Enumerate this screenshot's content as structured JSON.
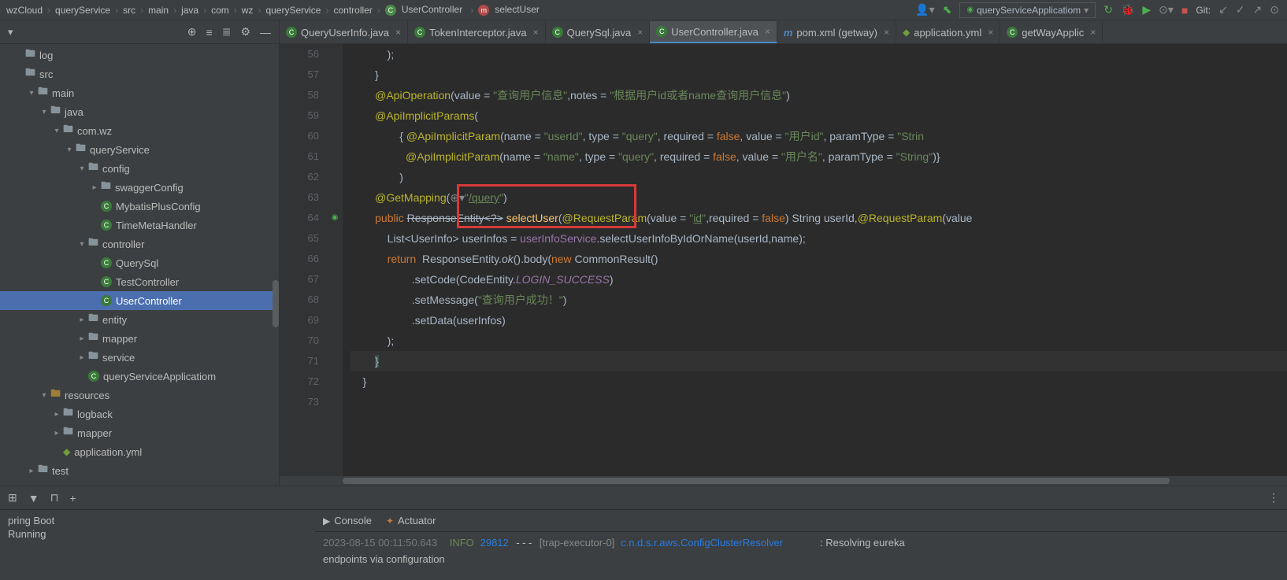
{
  "breadcrumb": [
    "wzCloud",
    "queryService",
    "src",
    "main",
    "java",
    "com",
    "wz",
    "queryService",
    "controller",
    "UserController",
    "selectUser"
  ],
  "runConfig": "queryServiceApplicatiom",
  "gitLabel": "Git:",
  "tree": {
    "items": [
      {
        "label": "log",
        "indent": 1,
        "kind": "folder",
        "arrow": ""
      },
      {
        "label": "src",
        "indent": 1,
        "kind": "folder",
        "arrow": ""
      },
      {
        "label": "main",
        "indent": 2,
        "kind": "folder",
        "arrow": "▾"
      },
      {
        "label": "java",
        "indent": 3,
        "kind": "folder",
        "arrow": "▾"
      },
      {
        "label": "com.wz",
        "indent": 4,
        "kind": "folder",
        "arrow": "▾"
      },
      {
        "label": "queryService",
        "indent": 5,
        "kind": "folder",
        "arrow": "▾"
      },
      {
        "label": "config",
        "indent": 6,
        "kind": "folder",
        "arrow": "▾"
      },
      {
        "label": "swaggerConfig",
        "indent": 7,
        "kind": "folder",
        "arrow": "▸"
      },
      {
        "label": "MybatisPlusConfig",
        "indent": 7,
        "kind": "class",
        "arrow": ""
      },
      {
        "label": "TimeMetaHandler",
        "indent": 7,
        "kind": "class",
        "arrow": ""
      },
      {
        "label": "controller",
        "indent": 6,
        "kind": "folder",
        "arrow": "▾"
      },
      {
        "label": "QuerySql",
        "indent": 7,
        "kind": "class",
        "arrow": ""
      },
      {
        "label": "TestController",
        "indent": 7,
        "kind": "class",
        "arrow": ""
      },
      {
        "label": "UserController",
        "indent": 7,
        "kind": "class",
        "arrow": "",
        "selected": true
      },
      {
        "label": "entity",
        "indent": 6,
        "kind": "folder",
        "arrow": "▸"
      },
      {
        "label": "mapper",
        "indent": 6,
        "kind": "folder",
        "arrow": "▸"
      },
      {
        "label": "service",
        "indent": 6,
        "kind": "folder",
        "arrow": "▸"
      },
      {
        "label": "queryServiceApplicatiom",
        "indent": 6,
        "kind": "class-run",
        "arrow": ""
      },
      {
        "label": "resources",
        "indent": 3,
        "kind": "folder-res",
        "arrow": "▾"
      },
      {
        "label": "logback",
        "indent": 4,
        "kind": "folder",
        "arrow": "▸"
      },
      {
        "label": "mapper",
        "indent": 4,
        "kind": "folder",
        "arrow": "▸"
      },
      {
        "label": "application.yml",
        "indent": 4,
        "kind": "yml",
        "arrow": ""
      },
      {
        "label": "test",
        "indent": 2,
        "kind": "folder",
        "arrow": "▸"
      }
    ]
  },
  "tabs": [
    {
      "label": "QueryUserInfo.java",
      "icon": "c"
    },
    {
      "label": "TokenInterceptor.java",
      "icon": "c"
    },
    {
      "label": "QuerySql.java",
      "icon": "c"
    },
    {
      "label": "UserController.java",
      "icon": "c",
      "active": true
    },
    {
      "label": "pom.xml (getway)",
      "icon": "m"
    },
    {
      "label": "application.yml",
      "icon": "y"
    },
    {
      "label": "getWayApplic",
      "icon": "c"
    }
  ],
  "lineStart": 56,
  "lineEnd": 73,
  "console": {
    "tabConsole": "Console",
    "tabActuator": "Actuator",
    "bootTitle": "pring Boot",
    "running": "Running",
    "logLine1_ts": "2023-08-15 00:11:50.643",
    "logLine1_level": "INFO",
    "logLine1_pid": "29812",
    "logLine1_thread": "[trap-executor-0]",
    "logLine1_class": "c.n.d.s.r.aws.ConfigClusterResolver",
    "logLine1_msg": ": Resolving eureka",
    "logLine2": "endpoints via configuration"
  }
}
